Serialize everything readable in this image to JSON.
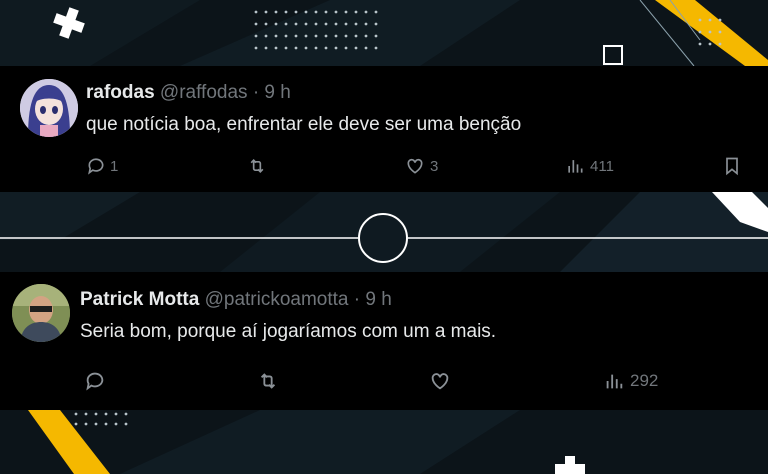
{
  "tweets": [
    {
      "display_name": "rafodas",
      "handle": "@raffodas",
      "time": "· 9 h",
      "text": "que notícia boa, enfrentar ele deve ser uma benção",
      "replies": "1",
      "retweets": "",
      "likes": "3",
      "views": "411"
    },
    {
      "display_name": "Patrick Motta",
      "handle": "@patrickoamotta",
      "time": "· 9 h",
      "text": "Seria bom, porque aí jogaríamos com um a mais.",
      "replies": "",
      "retweets": "",
      "likes": "",
      "views": "292"
    }
  ],
  "colors": {
    "accent": "#f5b800",
    "background": "#0c1419",
    "card": "#000000",
    "text": "#e7e9ea",
    "muted": "#71767b"
  }
}
